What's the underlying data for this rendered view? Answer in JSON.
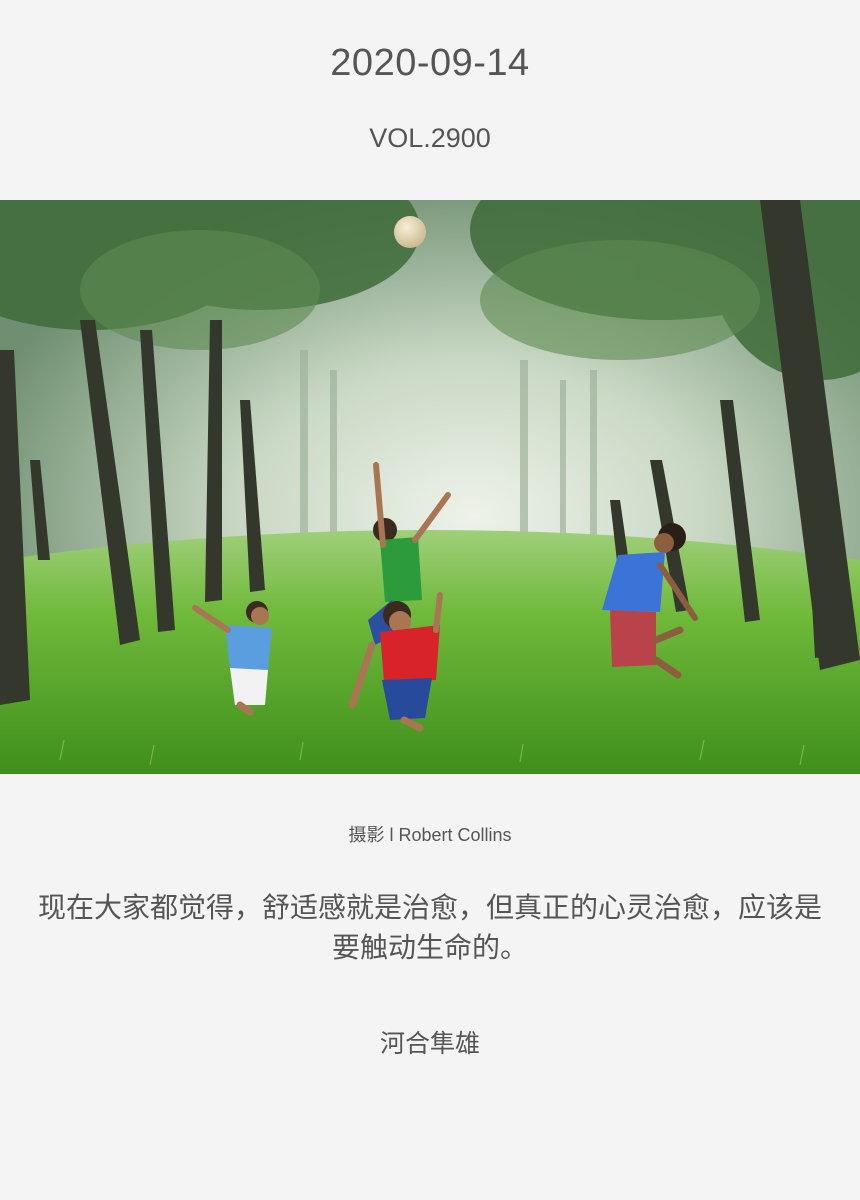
{
  "header": {
    "date": "2020-09-14",
    "volume": "VOL.2900"
  },
  "photo": {
    "subject": "children-playing-ball-in-forest",
    "colors": {
      "fog": "#dfe7dc",
      "grass": "#63b32a",
      "trunk": "#3b3a2e"
    }
  },
  "credit": {
    "text": "摄影 l Robert Collins"
  },
  "quote": {
    "text": "现在大家都觉得，舒适感就是治愈，但真正的心灵治愈，应该是要触动生命的。"
  },
  "author": {
    "name": "河合隼雄"
  }
}
